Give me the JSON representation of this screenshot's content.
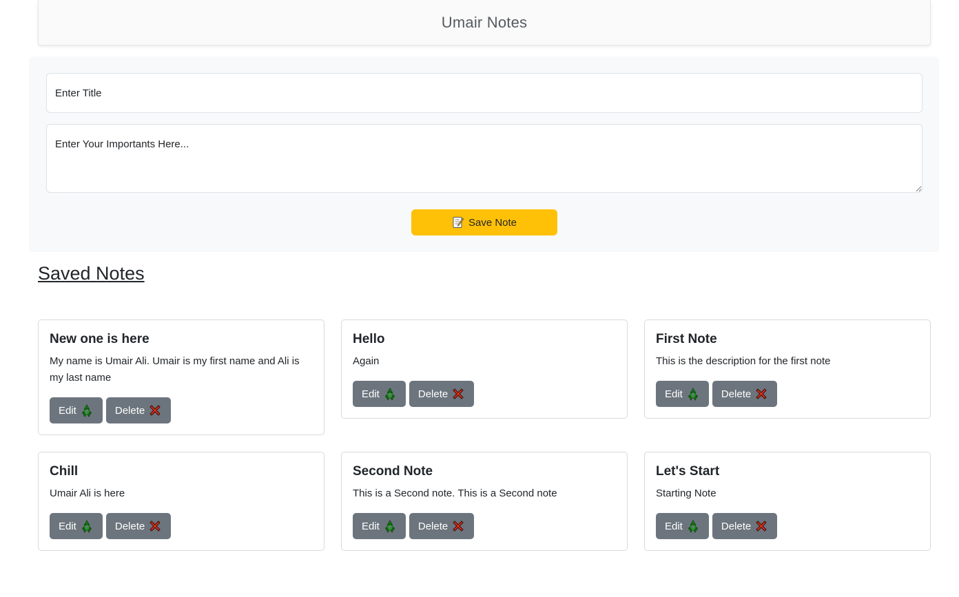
{
  "app": {
    "title": "Umair Notes"
  },
  "form": {
    "title_placeholder": "Enter Title",
    "description_placeholder": "Enter Your Importants Here...",
    "save_label": "Save Note",
    "save_icon": "memo-icon"
  },
  "saved": {
    "heading": "Saved Notes"
  },
  "notes": [
    {
      "title": "New one is here",
      "description": "My name is Umair Ali. Umair is my first name and Ali is my last name",
      "edit_label": "Edit",
      "delete_label": "Delete"
    },
    {
      "title": "Hello",
      "description": "Again",
      "edit_label": "Edit",
      "delete_label": "Delete"
    },
    {
      "title": "First Note",
      "description": "This is the description for the first note",
      "edit_label": "Edit",
      "delete_label": "Delete"
    },
    {
      "title": "Chill",
      "description": "Umair Ali is here",
      "edit_label": "Edit",
      "delete_label": "Delete"
    },
    {
      "title": "Second Note",
      "description": "This is a Second note. This is a Second note",
      "edit_label": "Edit",
      "delete_label": "Delete"
    },
    {
      "title": "Let's Start",
      "description": "Starting Note",
      "edit_label": "Edit",
      "delete_label": "Delete"
    }
  ],
  "colors": {
    "save_button": "#ffc107",
    "action_button": "#6c757d",
    "edit_icon": "#1fa31f",
    "delete_icon": "#e0301e"
  },
  "icons": {
    "edit": "recycle-icon",
    "delete": "cross-mark-icon"
  }
}
